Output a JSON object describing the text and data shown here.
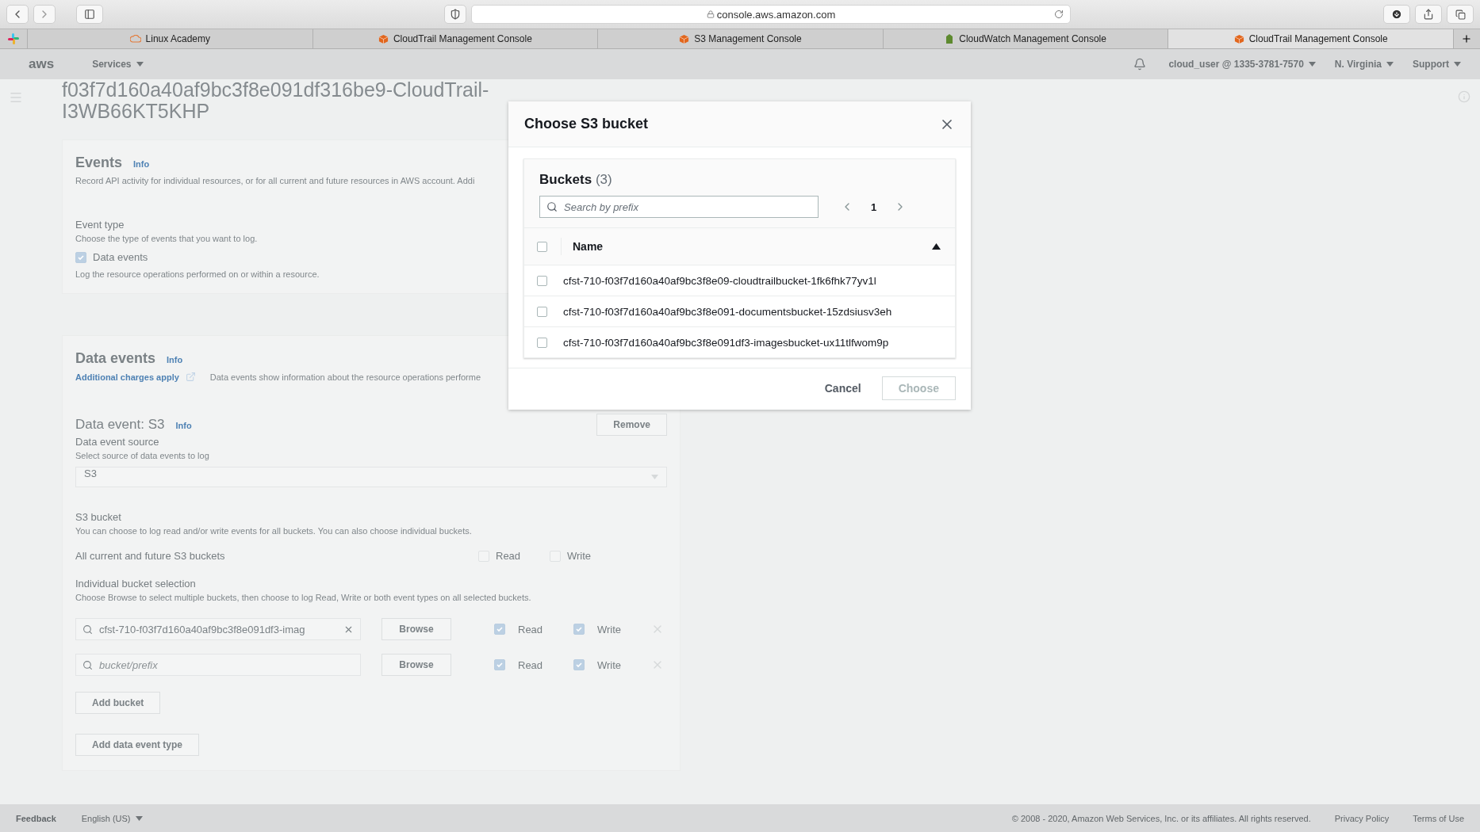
{
  "browser": {
    "url": "console.aws.amazon.com",
    "tabs": [
      {
        "label": "Linux Academy",
        "selected": false
      },
      {
        "label": "CloudTrail Management Console",
        "selected": false
      },
      {
        "label": "S3 Management Console",
        "selected": false
      },
      {
        "label": "CloudWatch Management Console",
        "selected": false
      },
      {
        "label": "CloudTrail Management Console",
        "selected": true
      }
    ]
  },
  "console_nav": {
    "logo": "aws",
    "services": "Services",
    "account": "cloud_user @ 1335-3781-7570",
    "region": "N. Virginia",
    "support": "Support"
  },
  "page": {
    "title_lines": [
      "f03f7d160a40af9bc3f8e091df316be9-CloudTrail-",
      "I3WB66KT5KHP"
    ],
    "events": {
      "title": "Events",
      "info": "Info",
      "description": "Record API activity for individual resources, or for all current and future resources in AWS account. Addi",
      "event_type_label": "Event type",
      "event_type_hint": "Choose the type of events that you want to log.",
      "data_events_option": {
        "label": "Data events",
        "checked": true
      },
      "data_events_hint": "Log the resource operations performed on or within a resource."
    },
    "data_events": {
      "title": "Data events",
      "info": "Info",
      "charges_link": "Additional charges apply",
      "description": "Data events show information about the resource operations performe",
      "event": {
        "title": "Data event: S3",
        "info": "Info",
        "remove": "Remove",
        "source_label": "Data event source",
        "source_hint": "Select source of data events to log",
        "source_value": "S3",
        "bucket_label": "S3 bucket",
        "bucket_hint": "You can choose to log read and/or write events for all buckets. You can also choose individual buckets.",
        "all_buckets": {
          "label": "All current and future S3 buckets",
          "read": {
            "label": "Read",
            "checked": false
          },
          "write": {
            "label": "Write",
            "checked": false
          }
        },
        "individual_label": "Individual bucket selection",
        "individual_hint": "Choose Browse to select multiple buckets, then choose to log Read, Write or both event types on all selected buckets.",
        "rows": [
          {
            "value": "cfst-710-f03f7d160a40af9bc3f8e091df3-imag",
            "browse": "Browse",
            "read": {
              "label": "Read",
              "checked": true
            },
            "write": {
              "label": "Write",
              "checked": true
            }
          },
          {
            "placeholder": "bucket/prefix",
            "browse": "Browse",
            "read": {
              "label": "Read",
              "checked": true
            },
            "write": {
              "label": "Write",
              "checked": true
            }
          }
        ],
        "add_bucket": "Add bucket"
      },
      "add_data_event_type": "Add data event type"
    }
  },
  "footer": {
    "feedback": "Feedback",
    "language": "English (US)",
    "copyright": "© 2008 - 2020, Amazon Web Services, Inc. or its affiliates. All rights reserved.",
    "links": [
      "Privacy Policy",
      "Terms of Use"
    ]
  },
  "modal": {
    "title": "Choose S3 bucket",
    "table_title": "Buckets",
    "count": "(3)",
    "search_placeholder": "Search by prefix",
    "page": "1",
    "column": "Name",
    "sort_ascending": true,
    "all_checked": false,
    "rows": [
      {
        "name": "cfst-710-f03f7d160a40af9bc3f8e09-cloudtrailbucket-1fk6fhk77yv1l",
        "selected": false
      },
      {
        "name": "cfst-710-f03f7d160a40af9bc3f8e091-documentsbucket-15zdsiusv3eh",
        "selected": false
      },
      {
        "name": "cfst-710-f03f7d160a40af9bc3f8e091df3-imagesbucket-ux11tlfwom9p",
        "selected": false
      }
    ],
    "cancel": "Cancel",
    "choose": {
      "label": "Choose",
      "disabled": true
    }
  }
}
